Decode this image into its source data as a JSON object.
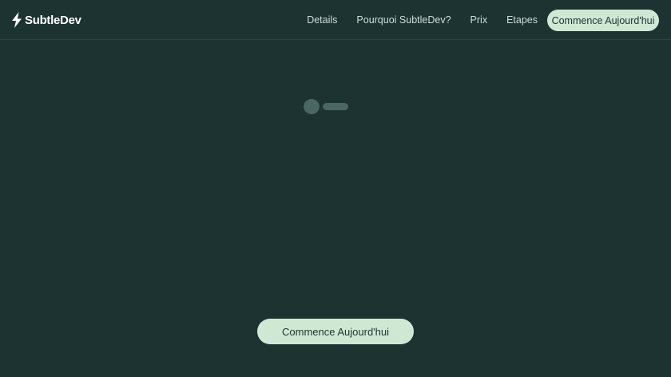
{
  "brand": {
    "name": "SubtleDev",
    "logo_icon": "lightning-bolt-icon"
  },
  "nav": {
    "items": [
      {
        "label": "Details"
      },
      {
        "label": "Pourquoi SubtleDev?"
      },
      {
        "label": "Prix"
      },
      {
        "label": "Etapes"
      }
    ],
    "cta_label": "Commence Aujourd'hui"
  },
  "main": {
    "cta_label": "Commence Aujourd'hui"
  },
  "colors": {
    "background": "#1c3331",
    "accent": "#cfe8d4",
    "skeleton": "#4a6761"
  }
}
